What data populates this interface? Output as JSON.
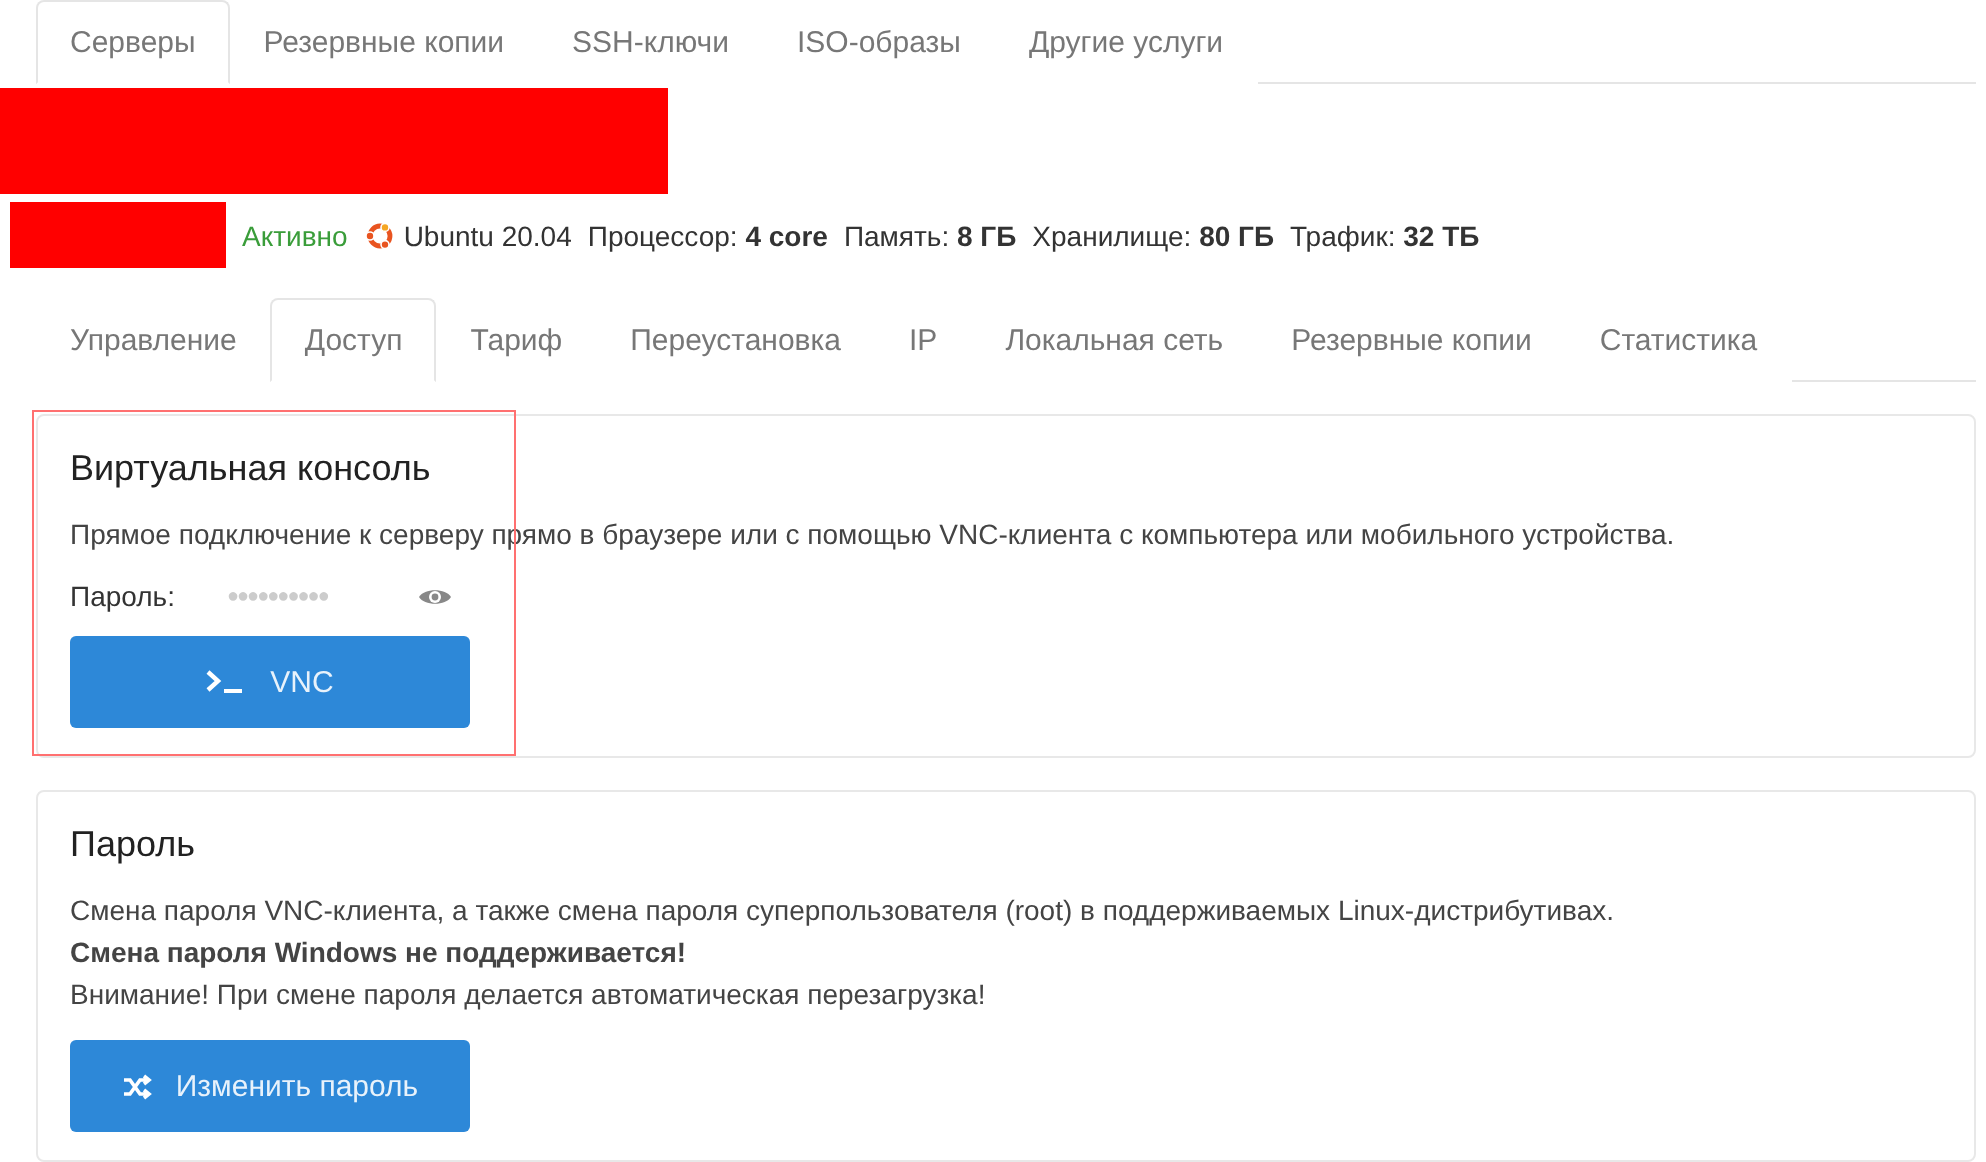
{
  "top_tabs": [
    {
      "label": "Серверы",
      "selected": true
    },
    {
      "label": "Резервные копии",
      "selected": false
    },
    {
      "label": "SSH-ключи",
      "selected": false
    },
    {
      "label": "ISO-образы",
      "selected": false
    },
    {
      "label": "Другие услуги",
      "selected": false
    }
  ],
  "server": {
    "status": "Активно",
    "os": "Ubuntu 20.04",
    "specs": [
      {
        "label": "Процессор:",
        "value": "4 core"
      },
      {
        "label": "Память:",
        "value": "8 ГБ"
      },
      {
        "label": "Хранилище:",
        "value": "80 ГБ"
      },
      {
        "label": "Трафик:",
        "value": "32 ТБ"
      }
    ]
  },
  "sub_tabs": [
    {
      "label": "Управление",
      "selected": false
    },
    {
      "label": "Доступ",
      "selected": true
    },
    {
      "label": "Тариф",
      "selected": false
    },
    {
      "label": "Переустановка",
      "selected": false
    },
    {
      "label": "IP",
      "selected": false
    },
    {
      "label": "Локальная сеть",
      "selected": false
    },
    {
      "label": "Резервные копии",
      "selected": false
    },
    {
      "label": "Статистика",
      "selected": false
    }
  ],
  "console_card": {
    "title": "Виртуальная консоль",
    "description": "Прямое подключение к серверу прямо в браузере или с помощью VNC-клиента с компьютера или мобильного устройства.",
    "password_label": "Пароль:",
    "password_mask": "●●●●●●●●●●",
    "button": "VNC",
    "highlighted": true
  },
  "password_card": {
    "title": "Пароль",
    "lines": [
      "Смена пароля VNC-клиента, а также смена пароля суперпользователя (root) в поддерживаемых Linux-дистрибутивах.",
      "**Смена пароля Windows не поддерживается!**",
      "Внимание! При смене пароля делается автоматическая перезагрузка!"
    ],
    "button": "Изменить пароль"
  }
}
